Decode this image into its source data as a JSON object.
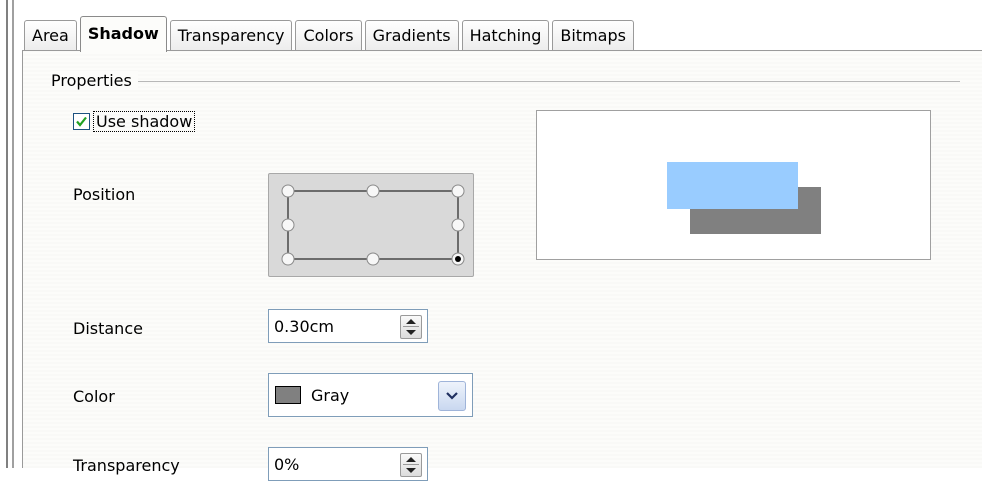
{
  "tabs": [
    {
      "label": "Area"
    },
    {
      "label": "Shadow",
      "active": true
    },
    {
      "label": "Transparency"
    },
    {
      "label": "Colors"
    },
    {
      "label": "Gradients"
    },
    {
      "label": "Hatching"
    },
    {
      "label": "Bitmaps"
    }
  ],
  "properties": {
    "section_title": "Properties",
    "use_shadow": {
      "label": "Use shadow",
      "checked": true
    },
    "position": {
      "label": "Position",
      "selected": "bottom-right"
    },
    "distance": {
      "label": "Distance",
      "value": "0.30cm"
    },
    "color": {
      "label": "Color",
      "value": "Gray",
      "swatch": "#808080"
    },
    "transparency": {
      "label": "Transparency",
      "value": "0%"
    }
  },
  "preview": {
    "object_color": "#99ccff",
    "shadow_color": "#808080"
  }
}
